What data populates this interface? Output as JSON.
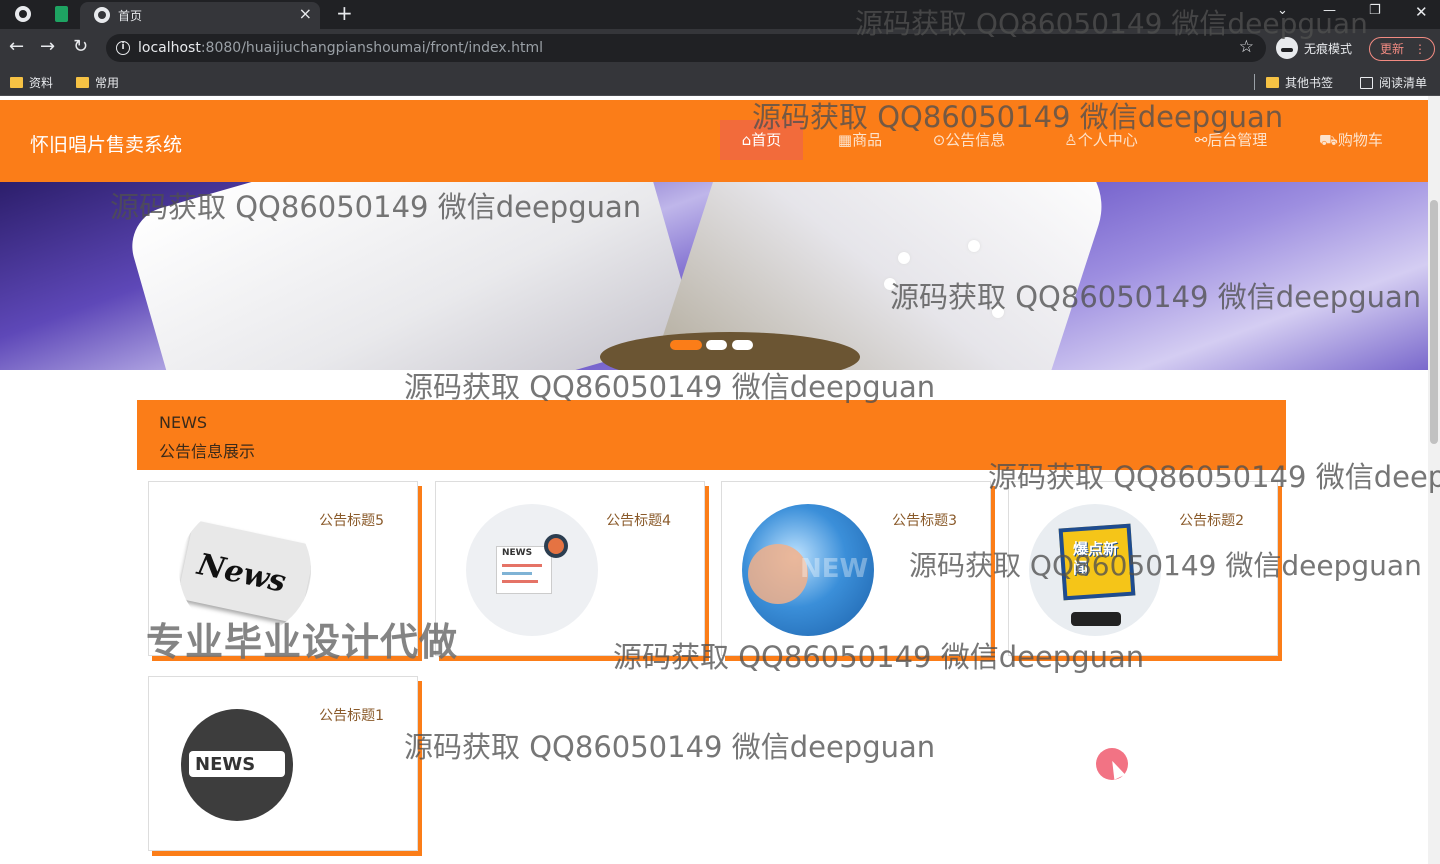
{
  "browser": {
    "tab_title": "首页",
    "tab_close": "×",
    "new_tab": "+",
    "url_host": "localhost",
    "url_rest": ":8080/huaijiuchangpianshoumai/front/index.html",
    "incognito_label": "无痕模式",
    "update_label": "更新",
    "bookmarks": [
      "资料",
      "常用"
    ],
    "other_bookmarks": "其他书签",
    "reading_list": "阅读清单"
  },
  "site": {
    "title": "怀旧唱片售卖系统",
    "nav": [
      {
        "icon": "⌂",
        "label": "首页"
      },
      {
        "icon": "▦",
        "label": "商品"
      },
      {
        "icon": "⊙",
        "label": "公告信息"
      },
      {
        "icon": "♙",
        "label": "个人中心"
      },
      {
        "icon": "⚯",
        "label": "后台管理"
      },
      {
        "icon": "⛟",
        "label": "购物车"
      }
    ],
    "active_nav": 0
  },
  "carousel": {
    "slide_count": 3,
    "active_index": 0
  },
  "news_section": {
    "heading_en": "NEWS",
    "heading_cn": "公告信息展示"
  },
  "news_cards": [
    {
      "title": "公告标题5",
      "image": "News"
    },
    {
      "title": "公告标题4",
      "image": "NEWS"
    },
    {
      "title": "公告标题3",
      "image": "NEW"
    },
    {
      "title": "公告标题2",
      "image": "爆点新闻"
    },
    {
      "title": "公告标题1",
      "image": "NEWS"
    }
  ],
  "watermarks": {
    "text": "源码获取 QQ86050149 微信deepguan",
    "partial": "源码获取 QQ86050149 微信deep",
    "big": "专业毕业设计代做"
  },
  "colors": {
    "accent": "#fb7d18",
    "nav_active": "#f26b3b"
  }
}
